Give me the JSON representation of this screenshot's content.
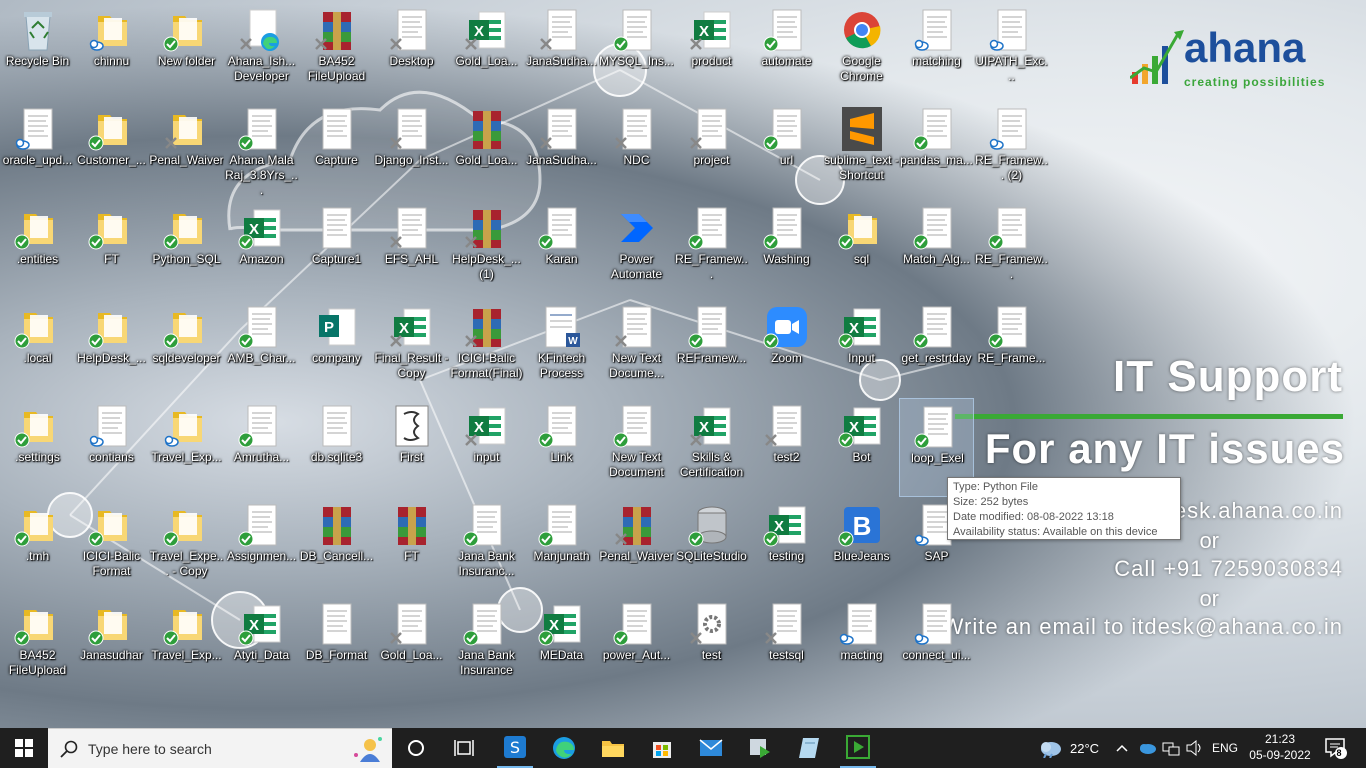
{
  "desktop": {
    "icons": [
      {
        "label": "Recycle Bin",
        "type": "recycle",
        "status": "none"
      },
      {
        "label": "chinnu",
        "type": "folder",
        "status": "cloud"
      },
      {
        "label": "New folder",
        "type": "folder",
        "status": "check"
      },
      {
        "label": "Ahana_Ish... Developer",
        "type": "edge",
        "status": "x"
      },
      {
        "label": "BA452 FileUpload",
        "type": "winrar",
        "status": "x"
      },
      {
        "label": "Desktop",
        "type": "doc",
        "status": "x"
      },
      {
        "label": "Gold_Loa...",
        "type": "excel",
        "status": "x"
      },
      {
        "label": "JanaSudha...",
        "type": "doc",
        "status": "xs"
      },
      {
        "label": "MYSQL_Ins...",
        "type": "doc",
        "status": "check"
      },
      {
        "label": "product",
        "type": "excel",
        "status": "x"
      },
      {
        "label": "automate",
        "type": "doc",
        "status": "check"
      },
      {
        "label": "Google Chrome",
        "type": "chrome",
        "status": "none"
      },
      {
        "label": "matching",
        "type": "doc",
        "status": "cloud"
      },
      {
        "label": "UIPATH_Exc...",
        "type": "doc",
        "status": "cloud"
      },
      {
        "label": "oracle_upd...",
        "type": "doc",
        "status": "cloud"
      },
      {
        "label": "Customer_...",
        "type": "folder",
        "status": "check"
      },
      {
        "label": "Penal_Waiver",
        "type": "folder",
        "status": "x"
      },
      {
        "label": "Ahana Mala Raj_3.8Yrs_...",
        "type": "doc",
        "status": "check"
      },
      {
        "label": "Capture",
        "type": "doc",
        "status": "none"
      },
      {
        "label": "Django_Inst...",
        "type": "doc",
        "status": "x"
      },
      {
        "label": "Gold_Loa...",
        "type": "winrar",
        "status": "none"
      },
      {
        "label": "JanaSudha...",
        "type": "doc",
        "status": "xs"
      },
      {
        "label": "NDC",
        "type": "doc",
        "status": "xs"
      },
      {
        "label": "project",
        "type": "doc",
        "status": "x"
      },
      {
        "label": "url",
        "type": "doc",
        "status": "check"
      },
      {
        "label": "sublime_text - Shortcut",
        "type": "sublime",
        "status": "none"
      },
      {
        "label": "pandas_ma...",
        "type": "doc",
        "status": "check"
      },
      {
        "label": "RE_Framew... (2)",
        "type": "doc",
        "status": "cloud"
      },
      {
        "label": ".entities",
        "type": "folder",
        "status": "check"
      },
      {
        "label": "FT",
        "type": "folder",
        "status": "check"
      },
      {
        "label": "Python_SQL",
        "type": "folder",
        "status": "check"
      },
      {
        "label": "Amazon",
        "type": "excel",
        "status": "check"
      },
      {
        "label": "Capture1",
        "type": "doc",
        "status": "none"
      },
      {
        "label": "EFS_AHL",
        "type": "doc",
        "status": "x"
      },
      {
        "label": "HelpDesk_... (1)",
        "type": "winrar",
        "status": "x"
      },
      {
        "label": "Karan",
        "type": "doc",
        "status": "check"
      },
      {
        "label": "Power Automate",
        "type": "power",
        "status": "none"
      },
      {
        "label": "RE_Framew...",
        "type": "doc",
        "status": "check"
      },
      {
        "label": "Washing",
        "type": "doc",
        "status": "check"
      },
      {
        "label": "sql",
        "type": "folder",
        "status": "check"
      },
      {
        "label": "Match_Alg...",
        "type": "doc",
        "status": "check"
      },
      {
        "label": "RE_Framew...",
        "type": "doc",
        "status": "check"
      },
      {
        "label": ".local",
        "type": "folder",
        "status": "check"
      },
      {
        "label": "HelpDesk_...",
        "type": "folder",
        "status": "check"
      },
      {
        "label": "sqldeveloper",
        "type": "folder",
        "status": "check"
      },
      {
        "label": "AMB_Char...",
        "type": "doc",
        "status": "check"
      },
      {
        "label": "company",
        "type": "publisher",
        "status": "none"
      },
      {
        "label": "Final_Result - Copy",
        "type": "excel",
        "status": "x"
      },
      {
        "label": "ICICI-Balic Format(Final)",
        "type": "winrar",
        "status": "x"
      },
      {
        "label": "KFintech Process",
        "type": "word",
        "status": "none"
      },
      {
        "label": "New Text Docume...",
        "type": "doc",
        "status": "x"
      },
      {
        "label": "REFramew...",
        "type": "doc",
        "status": "check"
      },
      {
        "label": "Zoom",
        "type": "zoom",
        "status": "check"
      },
      {
        "label": "Input",
        "type": "excel",
        "status": "check"
      },
      {
        "label": "get_restrtday",
        "type": "doc",
        "status": "check"
      },
      {
        "label": "RE_Frame...",
        "type": "doc",
        "status": "check"
      },
      {
        "label": ".settings",
        "type": "folder",
        "status": "check"
      },
      {
        "label": "contians",
        "type": "doc",
        "status": "cloud"
      },
      {
        "label": "Travel_Exp...",
        "type": "folder",
        "status": "cloud"
      },
      {
        "label": "Amrutha...",
        "type": "doc",
        "status": "check"
      },
      {
        "label": "db.sqlite3",
        "type": "doc",
        "status": "none"
      },
      {
        "label": "First",
        "type": "script",
        "status": "none"
      },
      {
        "label": "input",
        "type": "excel",
        "status": "x"
      },
      {
        "label": "Link",
        "type": "doc",
        "status": "check"
      },
      {
        "label": "New Text Document",
        "type": "doc",
        "status": "check"
      },
      {
        "label": "Skills & Certification",
        "type": "excel",
        "status": "x"
      },
      {
        "label": "test2",
        "type": "doc",
        "status": "xs"
      },
      {
        "label": "Bot",
        "type": "excel",
        "status": "check"
      },
      {
        "label": "loop_Exel",
        "type": "doc",
        "status": "check"
      },
      {
        "label": ".tmh",
        "type": "folder",
        "status": "check"
      },
      {
        "label": "ICICI-Balic Format",
        "type": "folder",
        "status": "check"
      },
      {
        "label": "Travel_Expe... - Copy",
        "type": "folder",
        "status": "check"
      },
      {
        "label": "Assignmen...",
        "type": "doc",
        "status": "check"
      },
      {
        "label": "DB_Cancell...",
        "type": "winrar",
        "status": "none"
      },
      {
        "label": "FT",
        "type": "winrar",
        "status": "none"
      },
      {
        "label": "Jana Bank Insuranc...",
        "type": "doc",
        "status": "check"
      },
      {
        "label": "Manjunath",
        "type": "doc",
        "status": "check"
      },
      {
        "label": "Penal_Waiver",
        "type": "winrar",
        "status": "x"
      },
      {
        "label": "SQLiteStudio",
        "type": "sqlite",
        "status": "check"
      },
      {
        "label": "testing",
        "type": "excel",
        "status": "check"
      },
      {
        "label": "BlueJeans",
        "type": "bluejeans",
        "status": "check"
      },
      {
        "label": "SAP",
        "type": "doc",
        "status": "cloud"
      },
      {
        "label": "BA452 FileUpload",
        "type": "folder",
        "status": "check"
      },
      {
        "label": "Janasudhar",
        "type": "folder",
        "status": "check"
      },
      {
        "label": "Travel_Exp...",
        "type": "folder",
        "status": "check"
      },
      {
        "label": "Atyti_Data",
        "type": "excel",
        "status": "check"
      },
      {
        "label": "DB_Format",
        "type": "doc",
        "status": "none"
      },
      {
        "label": "Gold_Loa...",
        "type": "doc",
        "status": "xs"
      },
      {
        "label": "Jana Bank Insurance",
        "type": "doc",
        "status": "check"
      },
      {
        "label": "MEData",
        "type": "excel",
        "status": "check"
      },
      {
        "label": "power_Aut...",
        "type": "doc",
        "status": "check"
      },
      {
        "label": "test",
        "type": "gear",
        "status": "x"
      },
      {
        "label": "testsql",
        "type": "doc",
        "status": "x"
      },
      {
        "label": "macting",
        "type": "doc",
        "status": "cloud"
      },
      {
        "label": "connect_ui...",
        "type": "doc",
        "status": "cloud"
      }
    ],
    "selected_label": "loop_Exel"
  },
  "tooltip": {
    "type": "Type: Python File",
    "size": "Size: 252 bytes",
    "modified": "Date modified: 08-08-2022 13:18",
    "availability": "Availability status: Available on this device"
  },
  "wallpaper": {
    "logo_name": "ahana",
    "logo_tagline": "creating possibilities",
    "heading": "IT Support",
    "subheading": "For any IT issues",
    "line1": "Log a ticket at itdesk.ahana.co.in",
    "or1": "or",
    "line2": "Call +91 7259030834",
    "or2": "or",
    "line3": "Write an email to itdesk@ahana.co.in"
  },
  "taskbar": {
    "search_placeholder": "Type here to search",
    "weather": "22°C",
    "language": "ENG",
    "time": "21:23",
    "date": "05-09-2022",
    "notification_count": "8"
  }
}
